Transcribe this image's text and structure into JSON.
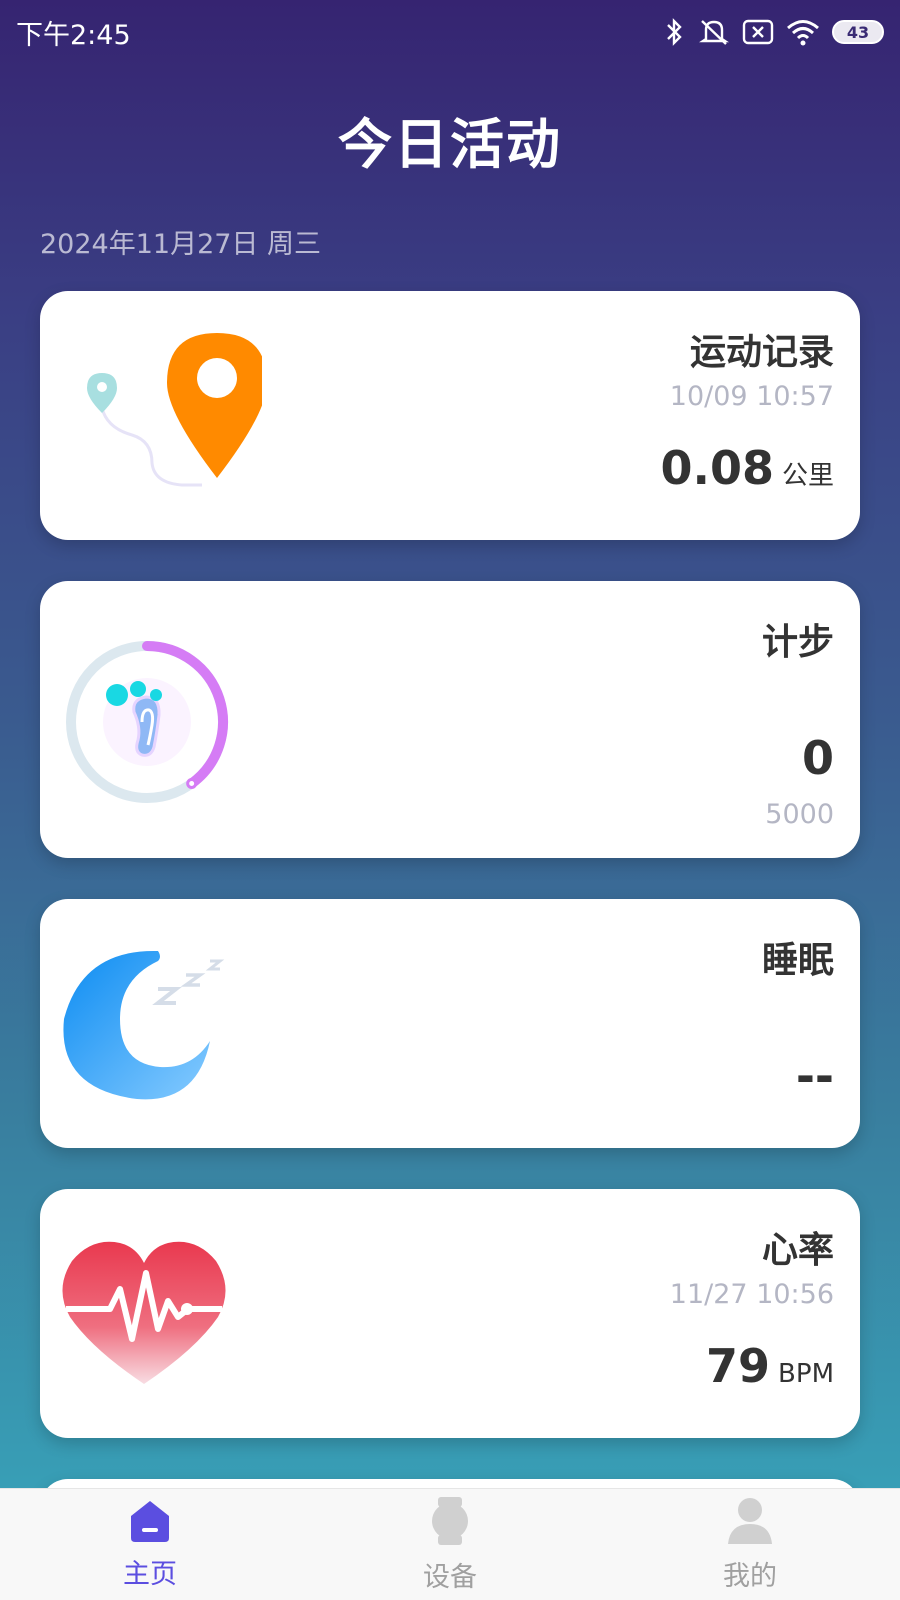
{
  "status_bar": {
    "time": "下午2:45",
    "battery": "43",
    "icons": [
      "bluetooth-icon",
      "mute-icon",
      "sim-off-icon",
      "wifi-icon",
      "battery-icon"
    ]
  },
  "header": {
    "title": "今日活动",
    "date": "2024年11月27日 周三"
  },
  "cards": {
    "exercise": {
      "title": "运动记录",
      "time": "10/09 10:57",
      "value": "0.08",
      "unit": "公里",
      "icon": "location-pin-icon"
    },
    "steps": {
      "title": "计步",
      "value": "0",
      "goal": "5000",
      "progress": 0.4,
      "icon": "footprint-icon"
    },
    "sleep": {
      "title": "睡眠",
      "value": "--",
      "icon": "moon-icon"
    },
    "heart": {
      "title": "心率",
      "time": "11/27 10:56",
      "value": "79",
      "unit": "BPM",
      "icon": "heart-rate-icon"
    }
  },
  "tabbar": {
    "items": [
      {
        "label": "主页",
        "icon": "home-icon",
        "active": true
      },
      {
        "label": "设备",
        "icon": "watch-icon",
        "active": false
      },
      {
        "label": "我的",
        "icon": "profile-icon",
        "active": false
      }
    ]
  },
  "colors": {
    "accent": "#5b4ee0",
    "pin": "#ff8a00",
    "heart": "#e8455a",
    "moon": "#1a90f0",
    "ring": "#d57cf5"
  }
}
